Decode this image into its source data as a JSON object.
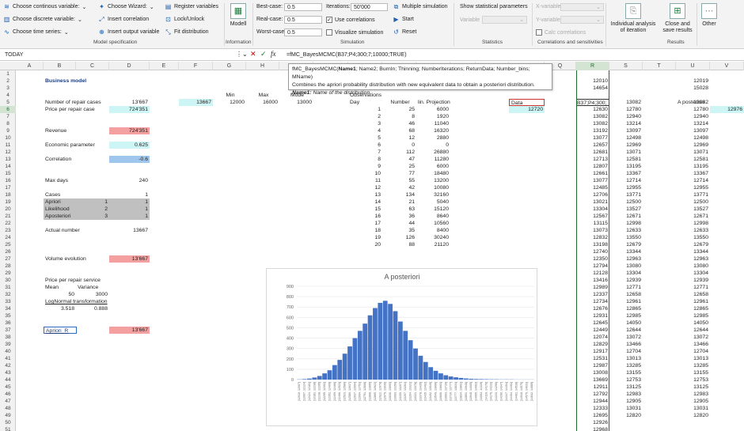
{
  "ribbon": {
    "continuous": "Choose continous variable:",
    "discrete": "Choose discrete variable:",
    "timeseries": "Choose time series:",
    "wizard": "Choose Wizard:",
    "insert_corr": "Insert correlation",
    "insert_output": "Insert output variable",
    "register": "Register variables",
    "lock": "Lock/Unlock",
    "fit": "Fit distribution",
    "modell": "Modell",
    "best_label": "Best-case:",
    "best_val": "0.5",
    "real_label": "Real-case:",
    "real_val": "0.5",
    "worst_label": "Worst-case:",
    "worst_val": "0.5",
    "iter_label": "Iterations:",
    "iter_val": "50'000",
    "use_corr": "Use correlations",
    "visualize": "Visualize simulation",
    "multi": "Multiple simulation",
    "start": "Start",
    "reset": "Reset",
    "show_stats": "Show statistical parameters",
    "variable": "Variable",
    "xvar": "X-variable",
    "yvar": "Y-variable",
    "calc_corr": "Calc correlations",
    "indiv": "Individual analysis of iteration",
    "close": "Close and save results",
    "other": "Other",
    "groups": {
      "model_spec": "Model specification",
      "information": "Information",
      "simulation": "Simulation",
      "statistics": "Statistics",
      "corr": "Correlations and sensitivities",
      "results": "Results"
    }
  },
  "formula_bar": {
    "name": "TODAY",
    "formula": "=fMC_BayesMCMC(B37;P4;300;7;10000;TRUE)"
  },
  "tooltip": {
    "line1_fn": "fMC_BayesMCMC(",
    "line1_bold": "Name1",
    "line1_rest": "; Name2; BurnIn; Thinning; NumberIterations; ReturnData; Number_bins; MName)",
    "line2": "Combines the apriori probability distribution with new equivalent data to obtain a posteriori distribution.",
    "line3_bold": "Name1:",
    "line3_rest": " Name of the distribution"
  },
  "columns": [
    "A",
    "B",
    "C",
    "D",
    "E",
    "F",
    "G",
    "H",
    "I",
    "J",
    "K",
    "L",
    "M",
    "N",
    "O",
    "P",
    "Q",
    "R",
    "S",
    "T",
    "U",
    "V"
  ],
  "rows": [
    "1",
    "2",
    "3",
    "4",
    "5",
    "6",
    "7",
    "8",
    "9",
    "10",
    "11",
    "12",
    "13",
    "14",
    "15",
    "16",
    "17",
    "18",
    "19",
    "20",
    "21",
    "22",
    "23",
    "24",
    "25",
    "26",
    "27",
    "28",
    "29",
    "30",
    "31",
    "32",
    "33",
    "34",
    "35",
    "36",
    "37",
    "38",
    "39",
    "40",
    "41",
    "42",
    "43",
    "44",
    "45",
    "46",
    "47",
    "48",
    "49",
    "50",
    "51"
  ],
  "model": {
    "title": "Business model",
    "repair_cases": "Number of repair cases",
    "repair_cases_val": "13'667",
    "price": "Price per repair case",
    "price_val": "724'351",
    "revenue": "Revenue",
    "revenue_val": "724'351",
    "econ": "Economic parameter",
    "econ_val": "0.625",
    "corr": "Correlation",
    "corr_val": "-0.6",
    "maxdays": "Max days",
    "maxdays_val": "240",
    "cases": "Cases",
    "cases_val": "1",
    "apriori": "Apriori",
    "apriori_n": "1",
    "apriori_v": "1",
    "likelihood": "Likelihood",
    "likelihood_n": "2",
    "likelihood_v": "1",
    "aposteriori": "Aposteriori",
    "aposteriori_n": "3",
    "aposteriori_v": "1",
    "actual": "Actual number",
    "actual_val": "13667",
    "volume": "Volume evolution",
    "volume_val": "13'667",
    "price_service": "Price per repair service",
    "mean": "Mean",
    "variance": "Variance",
    "mean_val": "50",
    "variance_val": "3000",
    "lognormal": "LogNormal transformation",
    "ln1": "3.518",
    "ln2": "0.888",
    "apriori_r": "Apriori_R",
    "apriori_r_val": "13'667"
  },
  "minmax": {
    "min": "Min",
    "max": "Max",
    "mode": "Mode",
    "f5": "13667",
    "g5": "12000",
    "h5": "16000",
    "i5": "13000"
  },
  "obs": {
    "title": "Observations",
    "day": "Day",
    "number": "Number",
    "proj": "lin. Projection",
    "rows": [
      [
        "1",
        "25",
        "6000"
      ],
      [
        "2",
        "8",
        "1920"
      ],
      [
        "3",
        "46",
        "11040"
      ],
      [
        "4",
        "68",
        "16320"
      ],
      [
        "5",
        "12",
        "2880"
      ],
      [
        "6",
        "0",
        "0"
      ],
      [
        "7",
        "112",
        "26880"
      ],
      [
        "8",
        "47",
        "11280"
      ],
      [
        "9",
        "25",
        "6000"
      ],
      [
        "10",
        "77",
        "18480"
      ],
      [
        "11",
        "55",
        "13200"
      ],
      [
        "12",
        "42",
        "10080"
      ],
      [
        "13",
        "134",
        "32160"
      ],
      [
        "14",
        "21",
        "5040"
      ],
      [
        "15",
        "63",
        "15120"
      ],
      [
        "16",
        "36",
        "8640"
      ],
      [
        "17",
        "44",
        "10560"
      ],
      [
        "18",
        "35",
        "8400"
      ],
      [
        "19",
        "126",
        "30240"
      ],
      [
        "20",
        "88",
        "21120"
      ]
    ]
  },
  "data_label": "Data",
  "p6": "12720",
  "u5": "A posteriori",
  "v6": "12976",
  "col_r": [
    "12010",
    "14654",
    "",
    "B37;P4;300;",
    "12630",
    "13082",
    "13082",
    "13192",
    "13077",
    "12657",
    "12681",
    "12713",
    "12807",
    "12661",
    "13077",
    "12485",
    "12706",
    "13021",
    "13304",
    "12567",
    "13115",
    "13073",
    "12832",
    "13198",
    "12740",
    "12350",
    "12794",
    "12128",
    "13416",
    "12989",
    "12337",
    "12734",
    "12676",
    "12931",
    "12645",
    "12449",
    "12074",
    "12829",
    "12917",
    "12531",
    "12987",
    "13008",
    "13669",
    "12911",
    "12792",
    "12944",
    "12333",
    "12695",
    "12926",
    "12968"
  ],
  "col_s": [
    "",
    "",
    "",
    "13082",
    "12780",
    "12940",
    "13214",
    "13097",
    "12498",
    "12969",
    "13071",
    "12581",
    "13195",
    "13367",
    "12714",
    "12955",
    "13771",
    "12500",
    "13527",
    "12671",
    "12998",
    "12633",
    "13550",
    "12679",
    "13344",
    "12963",
    "13080",
    "13304",
    "12939",
    "12771",
    "12658",
    "12961",
    "12865",
    "12985",
    "14050",
    "12644",
    "13072",
    "13466",
    "12704",
    "13013",
    "13285",
    "13155",
    "12753",
    "13125",
    "12983",
    "12905",
    "13031",
    "12820"
  ],
  "col_u": [
    "12019",
    "15028",
    "",
    "13082",
    "12780",
    "12940",
    "13214",
    "13097",
    "12498",
    "12969",
    "13071",
    "12581",
    "13195",
    "13367",
    "12714",
    "12955",
    "13771",
    "12500",
    "13527",
    "12671",
    "12998",
    "12633",
    "13550",
    "12679",
    "13344",
    "12963",
    "13080",
    "13304",
    "12939",
    "12771",
    "12658",
    "12961",
    "12865",
    "12985",
    "14050",
    "12644",
    "13072",
    "13466",
    "12704",
    "13013",
    "13285",
    "13155",
    "12753",
    "13125",
    "12983",
    "12905",
    "13031",
    "12820"
  ],
  "chart_data": {
    "type": "bar",
    "title": "A posteriori",
    "ylim": [
      0,
      900
    ],
    "yticks": [
      "0",
      "100",
      "200",
      "300",
      "400",
      "500",
      "600",
      "700",
      "800",
      "900"
    ],
    "categories": [
      "[12010, 12067]",
      "[12067, 12124]",
      "[12124, 12181]",
      "[12181, 12238]",
      "[12238, 12295]",
      "[12295, 12352]",
      "[12352, 12409]",
      "[12409, 12466]",
      "[12466, 12523]",
      "[12523, 12580]",
      "[12580, 12637]",
      "[12637, 12694]",
      "[12694, 12751]",
      "[12751, 12808]",
      "[12808, 12865]",
      "[12865, 12922]",
      "[12922, 12979]",
      "[12979, 13036]",
      "[13036, 13093]",
      "[13093, 13150]",
      "[13150, 13207]",
      "[13207, 13264]",
      "[13264, 13321]",
      "[13321, 13378]",
      "[13378, 13435]",
      "[13435, 13492]",
      "[13492, 13549]",
      "[13549, 13606]",
      "[13606, 13663]",
      "[13663, 13720]",
      "[13720, 13777]",
      "[13777, 13834]",
      "[13834, 13891]",
      "[13891, 13948]",
      "[13948, 14005]",
      "[14005, 14062]",
      "[14062, 14119]",
      "[14119, 14176]",
      "[14176, 14233]",
      "[14233, 14290]",
      "[14290, 14347]",
      "[14347, 14404]",
      "[14404, 14461]",
      "[14461, 14518]",
      "[14518, 14575]",
      "[14575, 14632]",
      "[14632, 14689]"
    ],
    "values": [
      2,
      5,
      10,
      20,
      35,
      60,
      90,
      140,
      190,
      250,
      320,
      400,
      470,
      540,
      620,
      690,
      740,
      760,
      730,
      660,
      560,
      470,
      380,
      300,
      230,
      170,
      120,
      85,
      60,
      42,
      30,
      22,
      16,
      11,
      8,
      6,
      5,
      4,
      3,
      3,
      2,
      2,
      2,
      1,
      1,
      1,
      1
    ]
  }
}
